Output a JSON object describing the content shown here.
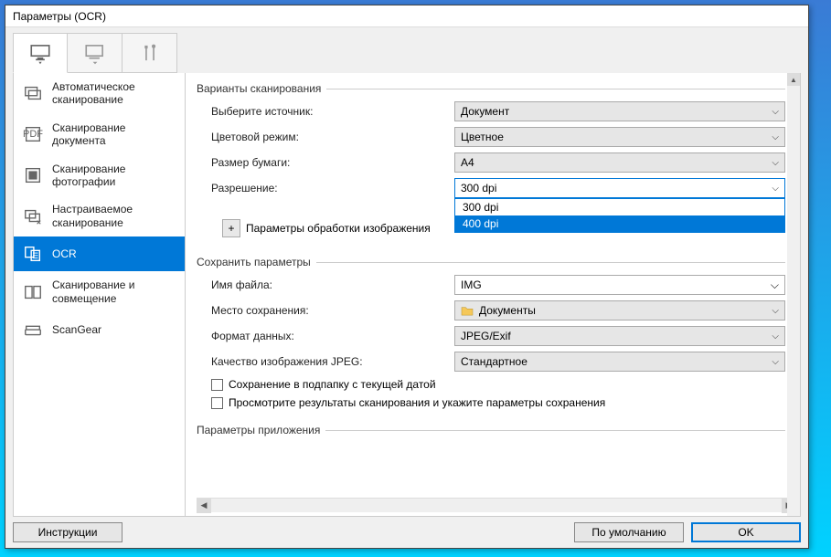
{
  "window": {
    "title": "Параметры (OCR)"
  },
  "tool_tabs": [
    {
      "id": "tab-monitor",
      "icon": "monitor-icon"
    },
    {
      "id": "tab-send",
      "icon": "send-icon"
    },
    {
      "id": "tab-tools",
      "icon": "tools-icon"
    }
  ],
  "sidebar": {
    "items": [
      {
        "icon": "auto-scan-icon",
        "label": "Автоматическое сканирование"
      },
      {
        "icon": "pdf-doc-icon",
        "label": "Сканирование документа"
      },
      {
        "icon": "photo-scan-icon",
        "label": "Сканирование фотографии"
      },
      {
        "icon": "custom-scan-icon",
        "label": "Настраиваемое сканирование"
      },
      {
        "icon": "ocr-icon",
        "label": "OCR"
      },
      {
        "icon": "stitch-icon",
        "label": "Сканирование и совмещение"
      },
      {
        "icon": "scangear-icon",
        "label": "ScanGear"
      }
    ],
    "active_index": 4
  },
  "scan_options": {
    "title": "Варианты сканирования",
    "source_label": "Выберите источник:",
    "source_value": "Документ",
    "color_label": "Цветовой режим:",
    "color_value": "Цветное",
    "paper_label": "Размер бумаги:",
    "paper_value": "A4",
    "res_label": "Разрешение:",
    "res_value": "300 dpi",
    "processing_label": "Параметры обработки изображения",
    "resolution_options": [
      "300 dpi",
      "400 dpi"
    ],
    "resolution_highlight_index": 1
  },
  "save_options": {
    "title": "Сохранить параметры",
    "filename_label": "Имя файла:",
    "filename_value": "IMG",
    "location_label": "Место сохранения:",
    "location_value": "Документы",
    "format_label": "Формат данных:",
    "format_value": "JPEG/Exif",
    "quality_label": "Качество изображения JPEG:",
    "quality_value": "Стандартное",
    "subfolder_check": "Сохранение в подпапку с текущей датой",
    "review_check": "Просмотрите результаты сканирования и укажите параметры сохранения"
  },
  "app_settings": {
    "title": "Параметры приложения"
  },
  "buttons": {
    "instructions": "Инструкции",
    "defaults": "По умолчанию",
    "ok": "OK"
  }
}
